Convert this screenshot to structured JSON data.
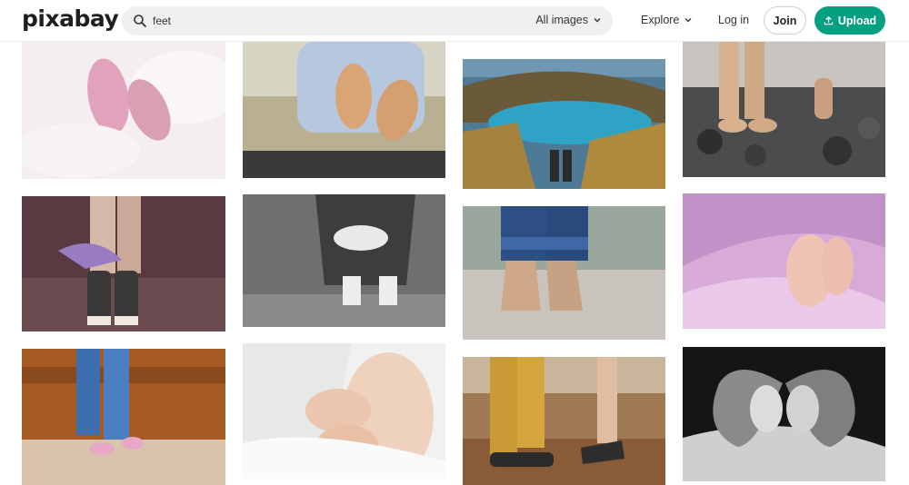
{
  "header": {
    "logo_text": "pixabay",
    "search": {
      "value": "feet",
      "filter_label": "All images"
    },
    "nav": {
      "explore_label": "Explore",
      "login_label": "Log in"
    },
    "join_label": "Join",
    "upload_label": "Upload"
  },
  "colors": {
    "accent": "#05a081",
    "search_bg": "#f0f0f0",
    "text": "#2b2b2b"
  },
  "gallery": {
    "photos": [
      {
        "subject": "baby feet pink soft focus"
      },
      {
        "subject": "baby sandy feet held by parent"
      },
      {
        "subject": "mountain lake with feet in foreground"
      },
      {
        "subject": "bare feet on dark pebbles"
      },
      {
        "subject": "girl legs in sneakers on ground"
      },
      {
        "subject": "person hugging knees black and white"
      },
      {
        "subject": "bare feet in jeans on wet ground"
      },
      {
        "subject": "baby feet on pink blanket"
      },
      {
        "subject": "legs in jeans and pink sneakers by rusty wall"
      },
      {
        "subject": "baby feet on white towel"
      },
      {
        "subject": "couple feet standing outdoors"
      },
      {
        "subject": "hands forming heart around baby feet"
      }
    ]
  }
}
